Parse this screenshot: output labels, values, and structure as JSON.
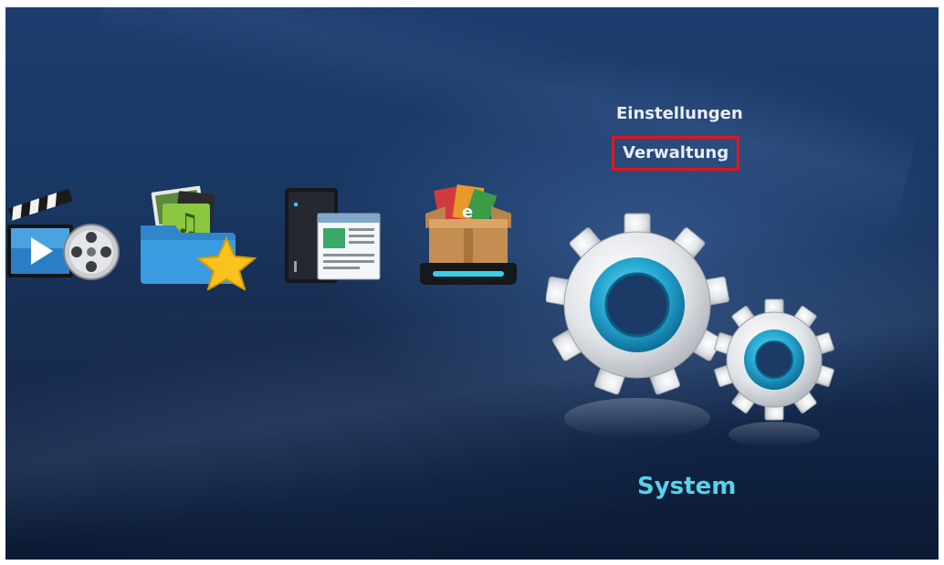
{
  "menu": {
    "items": [
      {
        "label": "Einstellungen",
        "highlighted": false
      },
      {
        "label": "Verwaltung",
        "highlighted": true
      }
    ]
  },
  "selected_app": {
    "label": "System",
    "icon": "gears-icon"
  },
  "apps": [
    {
      "icon": "video-icon"
    },
    {
      "icon": "music-photo-icon"
    },
    {
      "icon": "nas-server-icon"
    },
    {
      "icon": "package-box-icon"
    }
  ],
  "colors": {
    "background_top": "#1c3d6e",
    "background_bottom": "#0c1a33",
    "highlight_border": "#e4141b",
    "system_label": "#58d3ea",
    "menu_text": "#e8eef6",
    "gear_accent": "#2ab4d8"
  }
}
